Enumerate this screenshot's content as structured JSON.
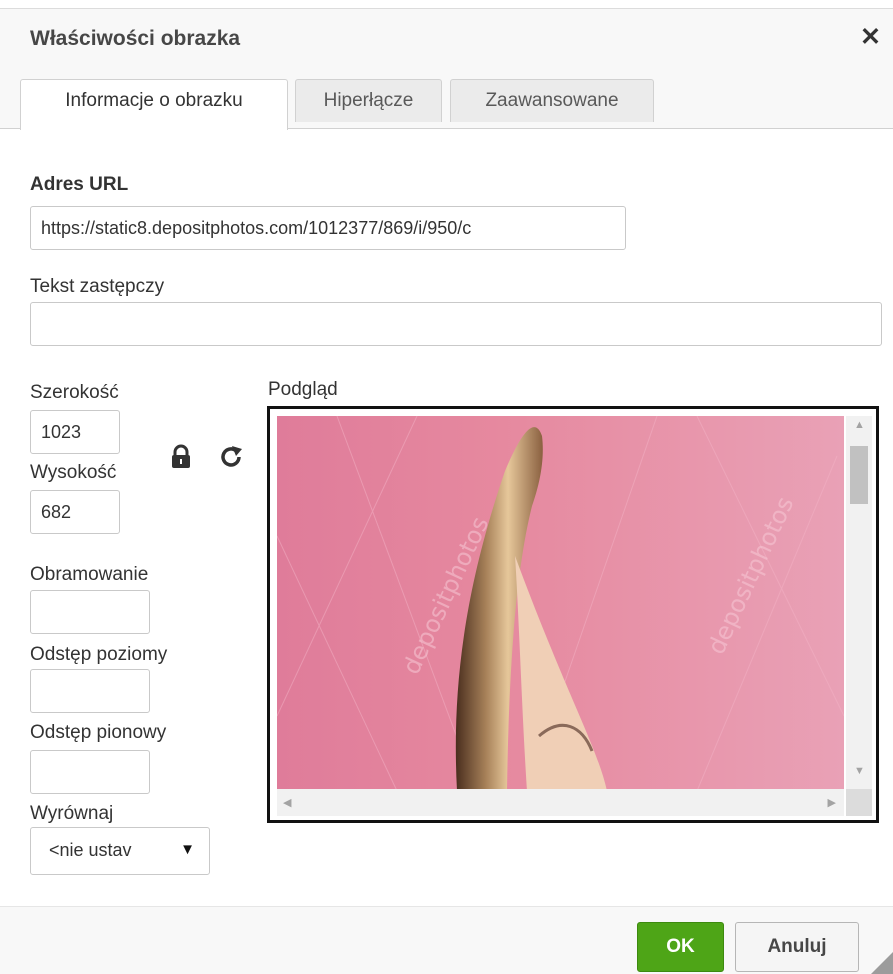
{
  "dialog": {
    "title": "Właściwości obrazka",
    "close_icon": "close-icon"
  },
  "tabs": [
    {
      "label": "Informacje o obrazku",
      "active": true
    },
    {
      "label": "Hiperłącze",
      "active": false
    },
    {
      "label": "Zaawansowane",
      "active": false
    }
  ],
  "form": {
    "url_label": "Adres URL",
    "url_value": "https://static8.depositphotos.com/1012377/869/i/950/c",
    "alt_label": "Tekst zastępczy",
    "alt_value": "",
    "width_label": "Szerokość",
    "width_value": "1023",
    "height_label": "Wysokość",
    "height_value": "682",
    "lock_icon": "lock-icon",
    "reset_icon": "reset-size-icon",
    "border_label": "Obramowanie",
    "border_value": "",
    "hspace_label": "Odstęp poziomy",
    "hspace_value": "",
    "vspace_label": "Odstęp pionowy",
    "vspace_value": "",
    "align_label": "Wyrównaj",
    "align_value": "<nie ustav"
  },
  "preview": {
    "label": "Podgląd",
    "watermark": "depositphotos"
  },
  "footer": {
    "ok_label": "OK",
    "cancel_label": "Anuluj"
  },
  "colors": {
    "ok_button": "#4ea517",
    "preview_background": "#e6899f"
  }
}
